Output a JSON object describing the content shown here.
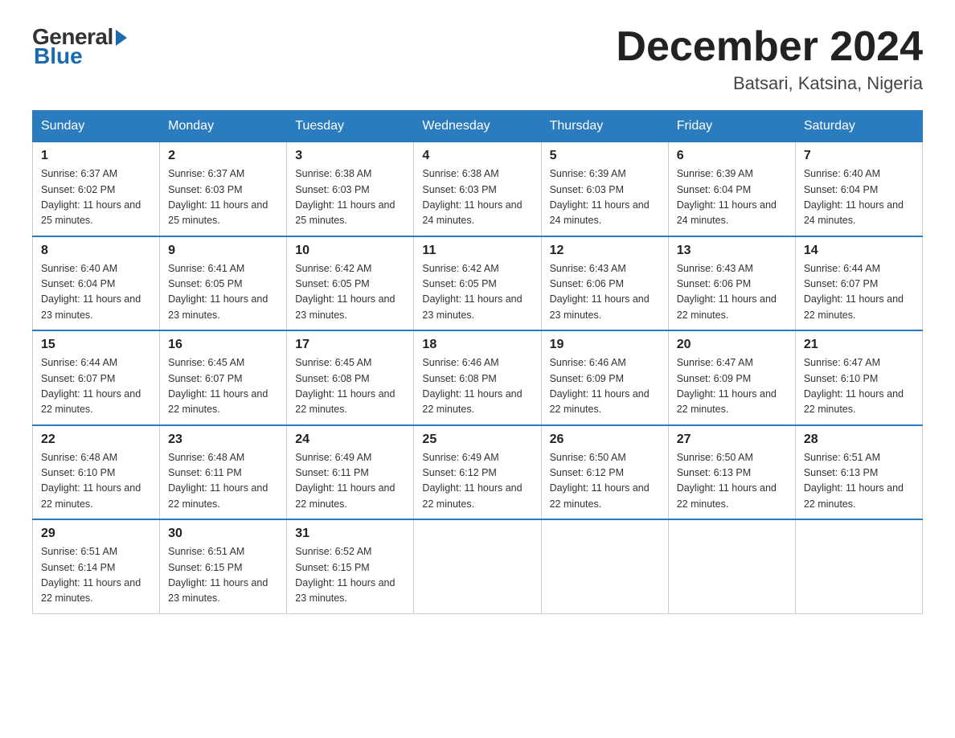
{
  "logo": {
    "general": "General",
    "blue": "Blue"
  },
  "title": "December 2024",
  "location": "Batsari, Katsina, Nigeria",
  "days_of_week": [
    "Sunday",
    "Monday",
    "Tuesday",
    "Wednesday",
    "Thursday",
    "Friday",
    "Saturday"
  ],
  "weeks": [
    [
      {
        "day": "1",
        "sunrise": "6:37 AM",
        "sunset": "6:02 PM",
        "daylight": "11 hours and 25 minutes."
      },
      {
        "day": "2",
        "sunrise": "6:37 AM",
        "sunset": "6:03 PM",
        "daylight": "11 hours and 25 minutes."
      },
      {
        "day": "3",
        "sunrise": "6:38 AM",
        "sunset": "6:03 PM",
        "daylight": "11 hours and 25 minutes."
      },
      {
        "day": "4",
        "sunrise": "6:38 AM",
        "sunset": "6:03 PM",
        "daylight": "11 hours and 24 minutes."
      },
      {
        "day": "5",
        "sunrise": "6:39 AM",
        "sunset": "6:03 PM",
        "daylight": "11 hours and 24 minutes."
      },
      {
        "day": "6",
        "sunrise": "6:39 AM",
        "sunset": "6:04 PM",
        "daylight": "11 hours and 24 minutes."
      },
      {
        "day": "7",
        "sunrise": "6:40 AM",
        "sunset": "6:04 PM",
        "daylight": "11 hours and 24 minutes."
      }
    ],
    [
      {
        "day": "8",
        "sunrise": "6:40 AM",
        "sunset": "6:04 PM",
        "daylight": "11 hours and 23 minutes."
      },
      {
        "day": "9",
        "sunrise": "6:41 AM",
        "sunset": "6:05 PM",
        "daylight": "11 hours and 23 minutes."
      },
      {
        "day": "10",
        "sunrise": "6:42 AM",
        "sunset": "6:05 PM",
        "daylight": "11 hours and 23 minutes."
      },
      {
        "day": "11",
        "sunrise": "6:42 AM",
        "sunset": "6:05 PM",
        "daylight": "11 hours and 23 minutes."
      },
      {
        "day": "12",
        "sunrise": "6:43 AM",
        "sunset": "6:06 PM",
        "daylight": "11 hours and 23 minutes."
      },
      {
        "day": "13",
        "sunrise": "6:43 AM",
        "sunset": "6:06 PM",
        "daylight": "11 hours and 22 minutes."
      },
      {
        "day": "14",
        "sunrise": "6:44 AM",
        "sunset": "6:07 PM",
        "daylight": "11 hours and 22 minutes."
      }
    ],
    [
      {
        "day": "15",
        "sunrise": "6:44 AM",
        "sunset": "6:07 PM",
        "daylight": "11 hours and 22 minutes."
      },
      {
        "day": "16",
        "sunrise": "6:45 AM",
        "sunset": "6:07 PM",
        "daylight": "11 hours and 22 minutes."
      },
      {
        "day": "17",
        "sunrise": "6:45 AM",
        "sunset": "6:08 PM",
        "daylight": "11 hours and 22 minutes."
      },
      {
        "day": "18",
        "sunrise": "6:46 AM",
        "sunset": "6:08 PM",
        "daylight": "11 hours and 22 minutes."
      },
      {
        "day": "19",
        "sunrise": "6:46 AM",
        "sunset": "6:09 PM",
        "daylight": "11 hours and 22 minutes."
      },
      {
        "day": "20",
        "sunrise": "6:47 AM",
        "sunset": "6:09 PM",
        "daylight": "11 hours and 22 minutes."
      },
      {
        "day": "21",
        "sunrise": "6:47 AM",
        "sunset": "6:10 PM",
        "daylight": "11 hours and 22 minutes."
      }
    ],
    [
      {
        "day": "22",
        "sunrise": "6:48 AM",
        "sunset": "6:10 PM",
        "daylight": "11 hours and 22 minutes."
      },
      {
        "day": "23",
        "sunrise": "6:48 AM",
        "sunset": "6:11 PM",
        "daylight": "11 hours and 22 minutes."
      },
      {
        "day": "24",
        "sunrise": "6:49 AM",
        "sunset": "6:11 PM",
        "daylight": "11 hours and 22 minutes."
      },
      {
        "day": "25",
        "sunrise": "6:49 AM",
        "sunset": "6:12 PM",
        "daylight": "11 hours and 22 minutes."
      },
      {
        "day": "26",
        "sunrise": "6:50 AM",
        "sunset": "6:12 PM",
        "daylight": "11 hours and 22 minutes."
      },
      {
        "day": "27",
        "sunrise": "6:50 AM",
        "sunset": "6:13 PM",
        "daylight": "11 hours and 22 minutes."
      },
      {
        "day": "28",
        "sunrise": "6:51 AM",
        "sunset": "6:13 PM",
        "daylight": "11 hours and 22 minutes."
      }
    ],
    [
      {
        "day": "29",
        "sunrise": "6:51 AM",
        "sunset": "6:14 PM",
        "daylight": "11 hours and 22 minutes."
      },
      {
        "day": "30",
        "sunrise": "6:51 AM",
        "sunset": "6:15 PM",
        "daylight": "11 hours and 23 minutes."
      },
      {
        "day": "31",
        "sunrise": "6:52 AM",
        "sunset": "6:15 PM",
        "daylight": "11 hours and 23 minutes."
      },
      null,
      null,
      null,
      null
    ]
  ],
  "labels": {
    "sunrise": "Sunrise:",
    "sunset": "Sunset:",
    "daylight": "Daylight:"
  }
}
